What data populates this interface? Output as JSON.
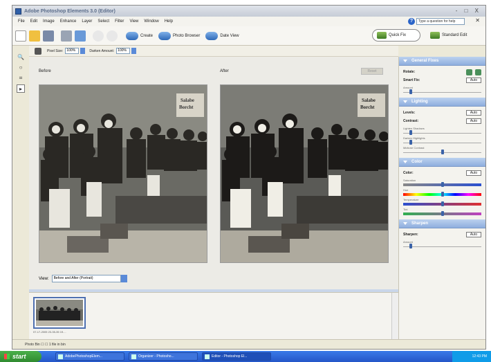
{
  "window": {
    "title": "Adobe Photoshop Elements 3.0 (Editor)",
    "controls": "- □ X"
  },
  "menu": {
    "items": [
      "File",
      "Edit",
      "Image",
      "Enhance",
      "Layer",
      "Select",
      "Filter",
      "View",
      "Window",
      "Help"
    ],
    "help_placeholder": "Type a question for help"
  },
  "toolbar": {
    "create": "Create",
    "photo_browser": "Photo Browser",
    "date_view": "Date View",
    "quick_fix": "Quick Fix",
    "standard_edit": "Standard Edit"
  },
  "options": {
    "pixel_size_label": "Pixel Size:",
    "pixel_size_value": "100%",
    "darken_label": "Darken Amount:",
    "darken_value": "100%"
  },
  "canvas": {
    "before_label": "Before",
    "after_label": "After",
    "reset_label": "Reset",
    "view_label": "View:",
    "view_value": "Before and After (Portrait)"
  },
  "bin": {
    "thumb_label": "07-17-2005 23-35-35 19...."
  },
  "status": {
    "text": "Photo Bin   ☐   ☐   1 file in bin"
  },
  "panels": {
    "general_fixes": {
      "title": "General Fixes",
      "rotate_label": "Rotate:",
      "smart_fix_label": "Smart Fix:",
      "auto": "Auto",
      "amount_label": "Amount",
      "amount": 0.1
    },
    "lighting": {
      "title": "Lighting",
      "levels_label": "Levels:",
      "contrast_label": "Contrast:",
      "auto": "Auto",
      "lighten_label": "Lighten Shadows",
      "lighten": 0.1,
      "darken_label": "Darken Highlights",
      "darken": 0.1,
      "midtone_label": "Midtone Contrast",
      "midtone": 0.5
    },
    "color": {
      "title": "Color",
      "color_label": "Color:",
      "auto": "Auto",
      "saturation_label": "Saturation",
      "saturation": 0.5,
      "hue_label": "Hue",
      "hue": 0.5,
      "temperature_label": "Temperature",
      "temperature": 0.5,
      "tint_label": "Tint",
      "tint": 0.5
    },
    "sharpen": {
      "title": "Sharpen",
      "sharpen_label": "Sharpen:",
      "auto": "Auto",
      "amount_label": "Amount",
      "amount": 0.1
    }
  },
  "taskbar": {
    "start": "start",
    "tasks": [
      "AdobePhotoshopElem...",
      "Organizer - Photosho...",
      "Editor - Photoshop El..."
    ],
    "clock": "12:43 PM"
  },
  "colors": {
    "panel_header": "#8eaede",
    "taskbar": "#2456c8",
    "start_green": "#2f8a2f"
  }
}
